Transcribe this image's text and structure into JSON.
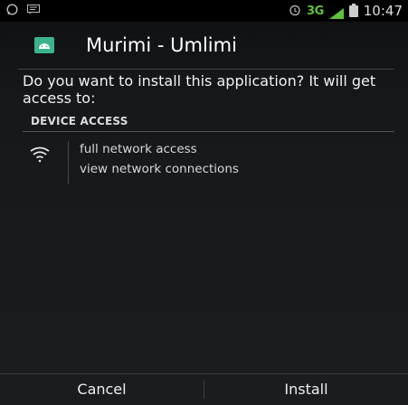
{
  "status_bar": {
    "network": "3G",
    "time": "10:47"
  },
  "title_bar": {
    "app_name": "Murimi - Umlimi"
  },
  "prompt": {
    "text": "Do you want to install this application? It will get access to:"
  },
  "permissions": {
    "section_title": "DEVICE ACCESS",
    "items": [
      {
        "label": "full network access",
        "icon": "wifi-icon"
      },
      {
        "label": "view network connections",
        "icon": "wifi-icon"
      }
    ]
  },
  "actions": {
    "cancel_label": "Cancel",
    "install_label": "Install"
  },
  "colors": {
    "accent_3g": "#5ec13a",
    "app_icon": "#3bb38c"
  }
}
